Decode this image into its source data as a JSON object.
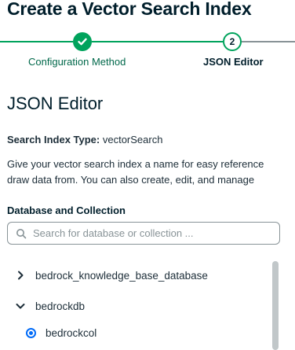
{
  "page": {
    "title": "Create a Vector Search Index"
  },
  "stepper": {
    "steps": [
      {
        "label": "Configuration Method",
        "state": "complete",
        "number": "1"
      },
      {
        "label": "JSON Editor",
        "state": "current",
        "number": "2"
      }
    ]
  },
  "editor": {
    "title": "JSON Editor",
    "index_type_label": "Search Index Type:",
    "index_type_value": " vectorSearch",
    "description_line1": "Give your vector search index a name for easy reference",
    "description_line2": "draw data from. You can also create, edit, and manage"
  },
  "database": {
    "label": "Database and Collection",
    "search_placeholder": "Search for database or collection ...",
    "search_value": "",
    "tree": [
      {
        "label": "bedrock_knowledge_base_database",
        "type": "database",
        "expanded": false
      },
      {
        "label": "bedrockdb",
        "type": "database",
        "expanded": true
      },
      {
        "label": "bedrockcol",
        "type": "collection",
        "selected": true
      }
    ]
  },
  "colors": {
    "accent_green": "#00a35c",
    "dark_green_text": "#00684a",
    "radio_blue": "#016bf8",
    "title_text": "#001e2b"
  },
  "icons": {
    "step_complete": "check-icon",
    "search": "search-icon",
    "collapsed": "chevron-right-icon",
    "expanded": "chevron-down-icon"
  }
}
